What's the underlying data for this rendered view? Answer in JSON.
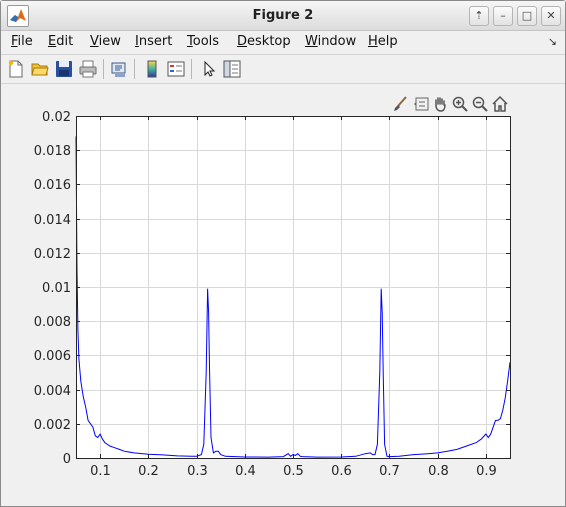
{
  "window": {
    "title": "Figure 2"
  },
  "window_controls": [
    "⇡",
    "–",
    "□",
    "✕"
  ],
  "menu": [
    {
      "label": "File",
      "u": "F",
      "rest": "ile"
    },
    {
      "label": "Edit",
      "u": "E",
      "rest": "dit"
    },
    {
      "label": "View",
      "u": "V",
      "rest": "iew"
    },
    {
      "label": "Insert",
      "u": "I",
      "rest": "nsert"
    },
    {
      "label": "Tools",
      "u": "T",
      "rest": "ools"
    },
    {
      "label": "Desktop",
      "u": "D",
      "rest": "esktop"
    },
    {
      "label": "Window",
      "u": "W",
      "rest": "indow"
    },
    {
      "label": "Help",
      "u": "H",
      "rest": "elp"
    }
  ],
  "toolbar_icons": [
    "new-figure-icon",
    "open-file-icon",
    "save-icon",
    "print-icon",
    "link-icon",
    "colorbar-icon",
    "legend-icon",
    "pointer-icon",
    "property-inspector-icon"
  ],
  "axes_toolbar_icons": [
    "brush-icon",
    "data-tips-icon",
    "pan-icon",
    "zoom-in-icon",
    "zoom-out-icon",
    "home-icon"
  ],
  "colors": {
    "line": "#0000ff",
    "grid": "#d9d9d9",
    "axes_bg": "#ffffff"
  },
  "chart_data": {
    "type": "line",
    "title": "",
    "xlabel": "",
    "ylabel": "",
    "xlim": [
      0.05,
      0.95
    ],
    "ylim": [
      0,
      0.02
    ],
    "grid": true,
    "xticks": [
      0.1,
      0.2,
      0.3,
      0.4,
      0.5,
      0.6,
      0.7,
      0.8,
      0.9
    ],
    "xtick_labels": [
      "0.1",
      "0.2",
      "0.3",
      "0.4",
      "0.5",
      "0.6",
      "0.7",
      "0.8",
      "0.9"
    ],
    "yticks": [
      0,
      0.002,
      0.004,
      0.006,
      0.008,
      0.01,
      0.012,
      0.014,
      0.016,
      0.018,
      0.02
    ],
    "ytick_labels": [
      "0",
      "0.002",
      "0.004",
      "0.006",
      "0.008",
      "0.01",
      "0.012",
      "0.014",
      "0.016",
      "0.018",
      "0.02"
    ],
    "series": [
      {
        "x": [
          0.05,
          0.052,
          0.054,
          0.056,
          0.06,
          0.065,
          0.07,
          0.075,
          0.08,
          0.085,
          0.09,
          0.095,
          0.1,
          0.105,
          0.11,
          0.12,
          0.13,
          0.14,
          0.15,
          0.17,
          0.2,
          0.23,
          0.26,
          0.29,
          0.3,
          0.31,
          0.315,
          0.32,
          0.323,
          0.325,
          0.327,
          0.33,
          0.335,
          0.34,
          0.345,
          0.35,
          0.36,
          0.38,
          0.4,
          0.45,
          0.48,
          0.49,
          0.495,
          0.5,
          0.505,
          0.51,
          0.515,
          0.52,
          0.55,
          0.6,
          0.63,
          0.65,
          0.66,
          0.665,
          0.67,
          0.675,
          0.68,
          0.683,
          0.685,
          0.687,
          0.69,
          0.695,
          0.7,
          0.72,
          0.75,
          0.78,
          0.8,
          0.82,
          0.84,
          0.86,
          0.88,
          0.89,
          0.9,
          0.905,
          0.91,
          0.915,
          0.92,
          0.925,
          0.93,
          0.935,
          0.94,
          0.945,
          0.95
        ],
        "y": [
          0.0188,
          0.011,
          0.0075,
          0.0058,
          0.0045,
          0.0036,
          0.003,
          0.0022,
          0.002,
          0.0018,
          0.0013,
          0.0012,
          0.0014,
          0.0011,
          0.0009,
          0.0007,
          0.0006,
          0.0005,
          0.0004,
          0.0003,
          0.00022,
          0.00018,
          0.00012,
          0.0001,
          0.0001,
          0.0002,
          0.0008,
          0.005,
          0.0099,
          0.0085,
          0.005,
          0.0012,
          0.0003,
          0.0004,
          0.0004,
          0.0002,
          0.0001,
          8e-05,
          6e-05,
          5e-05,
          8e-05,
          0.00025,
          0.0001,
          0.0002,
          0.00015,
          0.00025,
          0.0001,
          8e-05,
          5e-05,
          6e-05,
          0.0001,
          0.00025,
          0.0003,
          0.0002,
          0.0002,
          0.0008,
          0.005,
          0.0099,
          0.0085,
          0.005,
          0.0008,
          0.0001,
          8e-05,
          0.0001,
          0.0002,
          0.00025,
          0.0003,
          0.0004,
          0.0005,
          0.0007,
          0.0009,
          0.0011,
          0.0014,
          0.0012,
          0.0014,
          0.0018,
          0.0022,
          0.0022,
          0.0023,
          0.0028,
          0.0035,
          0.0045,
          0.0056
        ]
      }
    ]
  }
}
